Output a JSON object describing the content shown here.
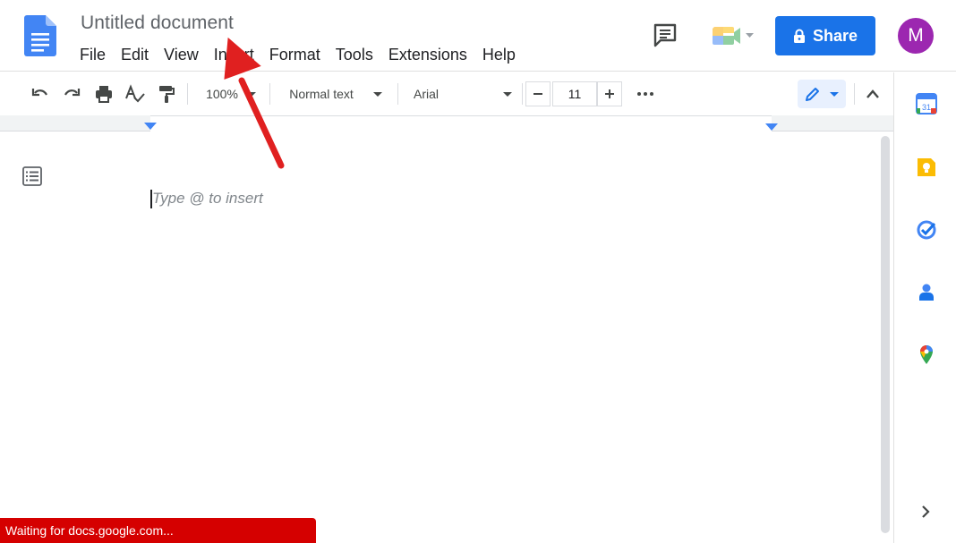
{
  "header": {
    "title": "Untitled document",
    "share_label": "Share",
    "avatar_letter": "M",
    "menu": [
      "File",
      "Edit",
      "View",
      "Insert",
      "Format",
      "Tools",
      "Extensions",
      "Help"
    ]
  },
  "toolbar": {
    "zoom": "100%",
    "style": "Normal text",
    "font": "Arial",
    "font_size": "11"
  },
  "document": {
    "placeholder": "Type @ to insert"
  },
  "status": {
    "text": "Waiting for docs.google.com..."
  },
  "side_panel": {
    "icons": [
      "calendar-icon",
      "keep-icon",
      "tasks-icon",
      "contacts-icon",
      "maps-icon"
    ]
  },
  "colors": {
    "accent": "#1a73e8",
    "avatar": "#9c27b0",
    "status_bar": "#d50000",
    "annotation_arrow": "#e02020"
  }
}
